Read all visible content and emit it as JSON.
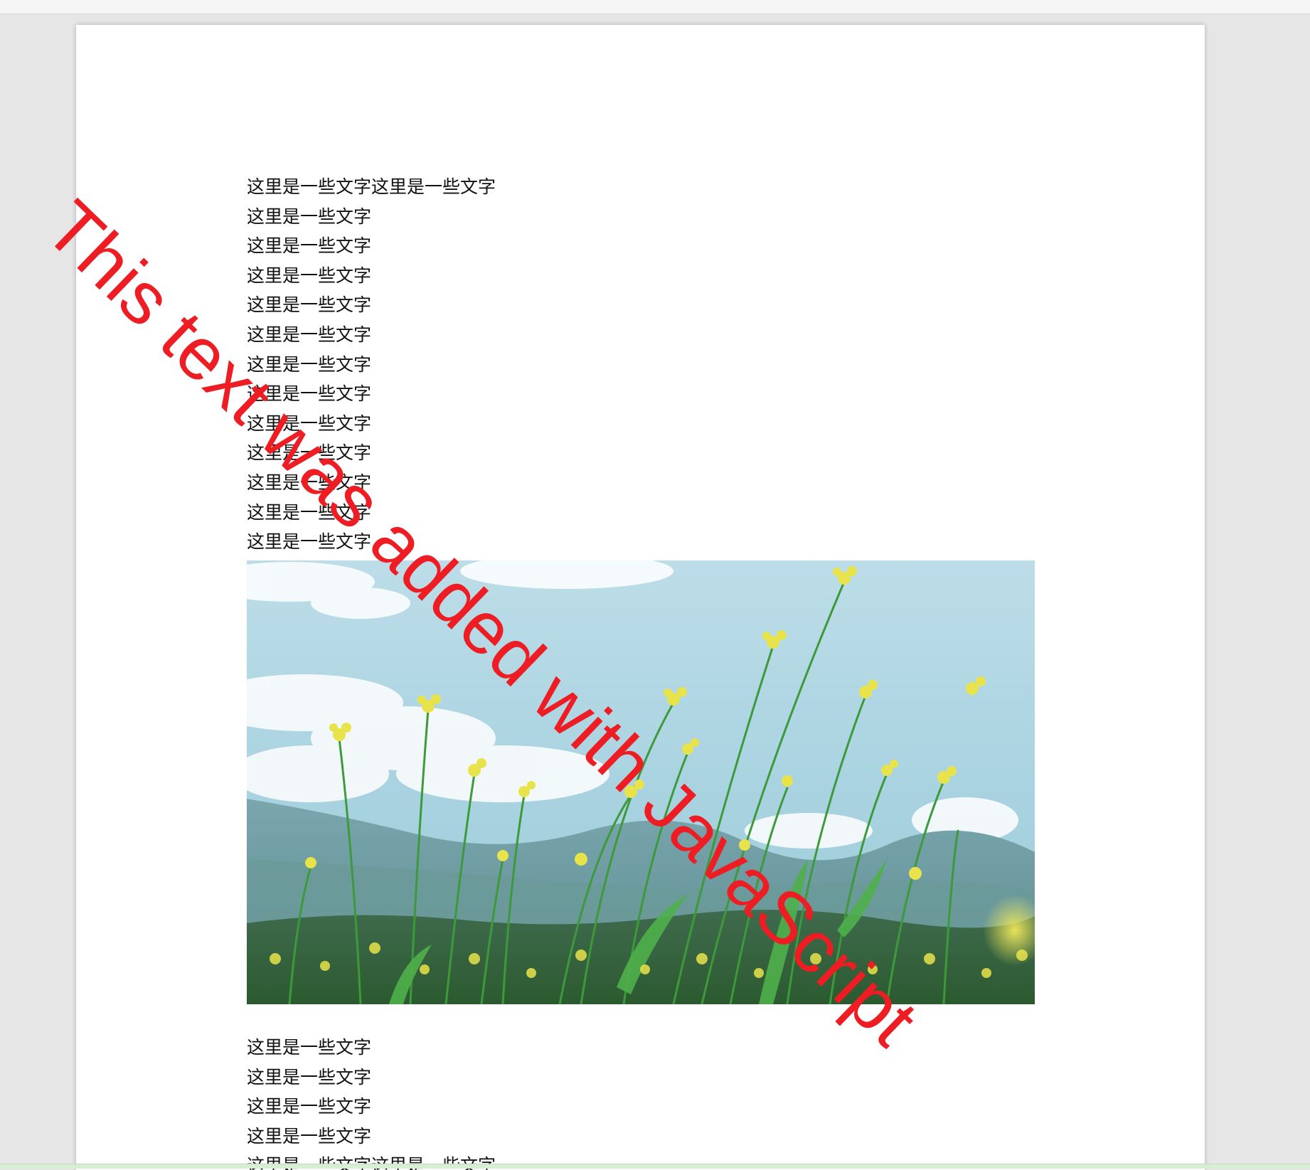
{
  "document": {
    "text_top": [
      "这里是一些文字这里是一些文字",
      "这里是一些文字",
      "这里是一些文字",
      "这里是一些文字",
      "这里是一些文字",
      "这里是一些文字",
      "这里是一些文字",
      "这里是一些文字",
      "这里是一些文字",
      "这里是一些文字",
      "这里是一些文字",
      "这里是一些文字",
      "这里是一些文字"
    ],
    "text_bottom": [
      "这里是一些文字",
      "这里是一些文字",
      "这里是一些文字",
      "这里是一些文字",
      "这里是一些文字这里是一些文字"
    ]
  },
  "watermark": {
    "text": "This text was added with JavaScript",
    "color": "#ee1c23"
  }
}
